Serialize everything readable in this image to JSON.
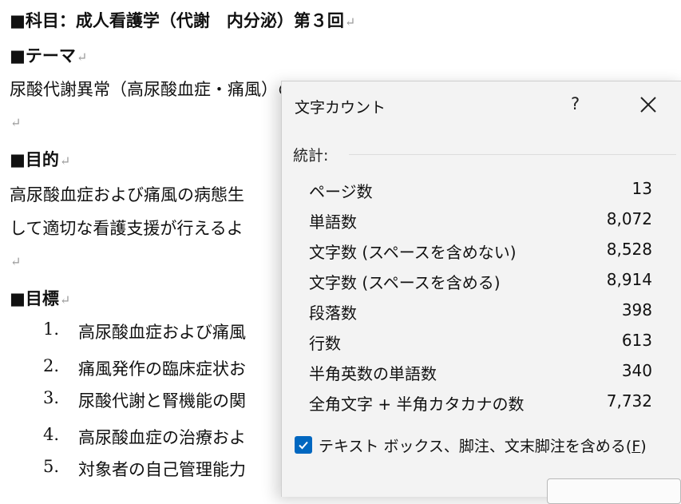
{
  "document": {
    "lines": [
      {
        "text": "■科目：成人看護学（代謝　内分泌）第３回",
        "bold": true
      },
      {
        "text": "■テーマ",
        "bold": true
      },
      {
        "text": "尿酸代謝異常（高尿酸血症・痛風）の病態と看護",
        "bold": false
      },
      {
        "text": "",
        "bold": false
      },
      {
        "text": "■目的",
        "bold": true
      },
      {
        "text": "高尿酸血症および痛風の病態生",
        "bold": false
      },
      {
        "text": "して適切な看護支援が行えるよ",
        "bold": false
      },
      {
        "text": "",
        "bold": false
      },
      {
        "text": "■目標",
        "bold": true
      }
    ],
    "para_mark": "↵",
    "list": [
      {
        "num": "1.",
        "text": "高尿酸血症および痛風"
      },
      {
        "num": "2.",
        "text": "痛風発作の臨床症状お"
      },
      {
        "num": "3.",
        "text": "尿酸代謝と腎機能の関"
      },
      {
        "num": "4.",
        "text": "高尿酸血症の治療およ"
      },
      {
        "num": "5.",
        "text": "対象者の自己管理能力"
      }
    ]
  },
  "dialog": {
    "title": "文字カウント",
    "help_label": "?",
    "close_icon": "close-icon",
    "stats_label": "統計:",
    "stats": [
      {
        "label": "ページ数",
        "value": "13"
      },
      {
        "label": "単語数",
        "value": "8,072"
      },
      {
        "label": "文字数 (スペースを含めない)",
        "value": "8,528"
      },
      {
        "label": "文字数 (スペースを含める)",
        "value": "8,914"
      },
      {
        "label": "段落数",
        "value": "398"
      },
      {
        "label": "行数",
        "value": "613"
      },
      {
        "label": "半角英数の単語数",
        "value": "340"
      },
      {
        "label": "全角文字 + 半角カタカナの数",
        "value": "7,732"
      }
    ],
    "checkbox": {
      "label": "テキスト ボックス、脚注、文末脚注を含める(",
      "accel": "F",
      "label_end": ")",
      "checked": true
    },
    "accent_color": "#0067c0"
  }
}
